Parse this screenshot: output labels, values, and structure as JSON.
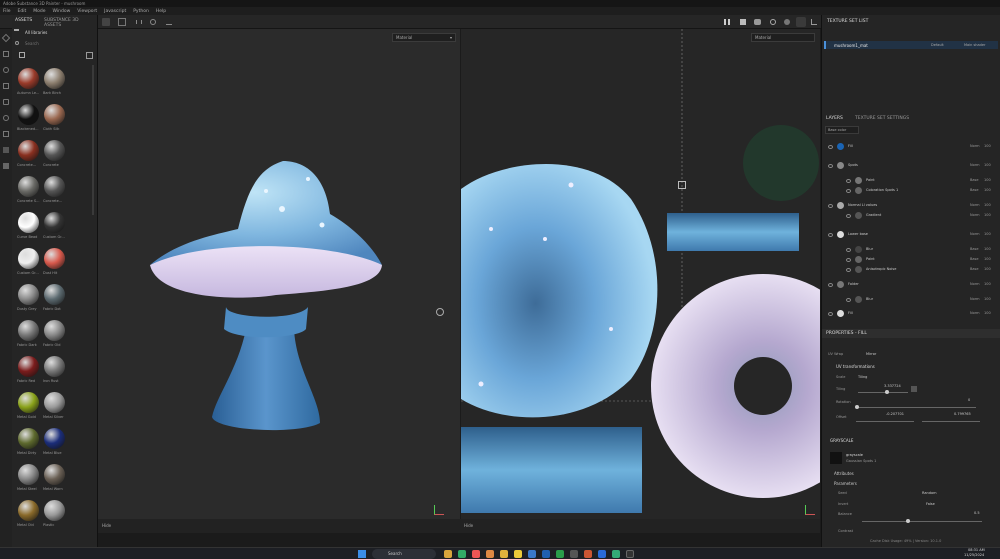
{
  "window": {
    "title": "Adobe Substance 3D Painter - mushroom"
  },
  "menu": [
    "File",
    "Edit",
    "Mode",
    "Window",
    "Viewport",
    "Javascript",
    "Python",
    "Help"
  ],
  "assets": {
    "tabs": [
      "ASSETS",
      "SUBSTANCE 3D ASSETS"
    ],
    "library": "All libraries",
    "search_placeholder": "Search",
    "items": [
      "Autumn Le...",
      "Bark Birch",
      "Blackened...",
      "Cloth Silk",
      "Concrete...",
      "Concrete",
      "Concrete S...",
      "Concrete...",
      "Curve Bead",
      "Custom Gr...",
      "Custom Gr...",
      "Dust Hit",
      "Dusty Grey",
      "Fabric Dot",
      "Fabric Dark",
      "Fabric Old",
      "Fabric Red",
      "Iron Rust",
      "Metal Gold",
      "Metal Silver",
      "Metal Dirty",
      "Metal Blue",
      "Metal Steel",
      "Metal Worn",
      "Metal Old",
      "Plastic"
    ]
  },
  "viewports": {
    "left_mode": "Material",
    "right_mode": "Material",
    "left_label": "Hide",
    "right_label": "Hide"
  },
  "texture_set": {
    "title": "TEXTURE SET LIST",
    "name": "mushroom1_mat",
    "shader": "Main shader",
    "uv": "Default"
  },
  "layers": {
    "tabs": [
      "LAYERS",
      "TEXTURE SET SETTINGS"
    ],
    "blend_mode": "Base color",
    "items": [
      {
        "name": "Fill",
        "blend": "Norm",
        "opacity": "100"
      },
      {
        "name": "Spots",
        "blend": "Norm",
        "opacity": "100"
      },
      {
        "name": "Paint",
        "blend": "Base",
        "opacity": "100"
      },
      {
        "name": "Coloration Spots 1",
        "blend": "Base",
        "opacity": "100"
      },
      {
        "name": "Normal Ll values",
        "blend": "Norm",
        "opacity": "100"
      },
      {
        "name": "Gradient",
        "blend": "Norm",
        "opacity": "100"
      },
      {
        "name": "Lower base",
        "blend": "Norm",
        "opacity": "100"
      },
      {
        "name": "Blur",
        "blend": "Base",
        "opacity": "100"
      },
      {
        "name": "Paint",
        "blend": "Base",
        "opacity": "100"
      },
      {
        "name": "Anisotropic Noise",
        "blend": "Base",
        "opacity": "100"
      },
      {
        "name": "Folder",
        "blend": "Norm",
        "opacity": "100"
      },
      {
        "name": "Blur",
        "blend": "Norm",
        "opacity": "100"
      },
      {
        "name": "Fill",
        "blend": "Norm",
        "opacity": "100"
      }
    ]
  },
  "properties": {
    "title": "PROPERTIES - FILL",
    "uv_wrap_label": "UV Wrap",
    "uv_wrap_value": "Mirror",
    "uv_transform": "UV transformations",
    "scale_label": "Scale",
    "scale_value": "Tiling",
    "tiling_label": "Tiling",
    "tiling_value": "3.337724",
    "rotation_label": "Rotation",
    "rotation_value": "0",
    "offset_label": "Offset",
    "offset_x": "-0.207701",
    "offset_y": "0.799765",
    "grayscale_section": "GRAYSCALE",
    "grayscale_name": "grayscale",
    "grayscale_sub": "Gaussian Spots 1",
    "attributes": "Attributes",
    "parameters": "Parameters",
    "p1_label": "Seed",
    "p1_value": "Random",
    "p2_label": "Invert",
    "p2_value": "False",
    "p3_label": "Balance",
    "p3_value": "0.5",
    "p4_label": "Contrast",
    "p4_value": ""
  },
  "status": {
    "text": "Cache Disk Usage: 49% | Version: 10.1.0",
    "time": "08:31 AM",
    "date": "11/25/2024"
  },
  "taskbar": {
    "search": "Search"
  }
}
